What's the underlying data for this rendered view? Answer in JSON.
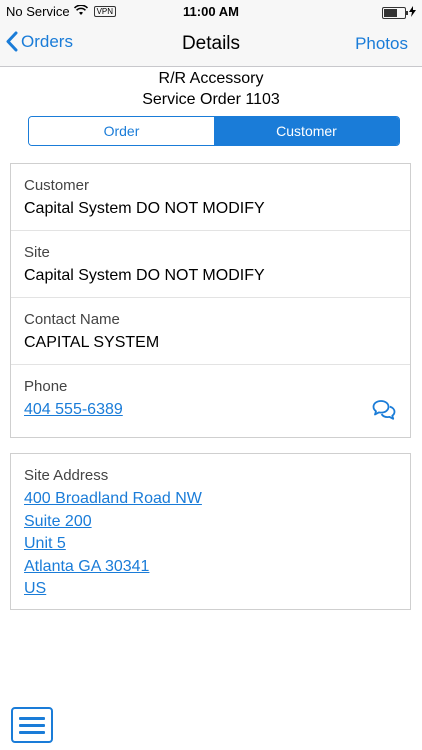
{
  "status_bar": {
    "carrier": "No Service",
    "vpn": "VPN",
    "time": "11:00 AM"
  },
  "nav": {
    "back_label": "Orders",
    "title": "Details",
    "right_label": "Photos"
  },
  "header": {
    "line1": "R/R Accessory",
    "line2": "Service Order 1103"
  },
  "tabs": [
    {
      "label": "Order",
      "selected": false
    },
    {
      "label": "Customer",
      "selected": true
    }
  ],
  "customer_card": {
    "customer_label": "Customer",
    "customer_value": "Capital System DO NOT MODIFY",
    "site_label": "Site",
    "site_value": "Capital System DO NOT MODIFY",
    "contact_label": "Contact Name",
    "contact_value": "CAPITAL SYSTEM",
    "phone_label": "Phone",
    "phone_value": "404 555-6389"
  },
  "address_card": {
    "label": "Site Address",
    "lines": [
      "400 Broadland Road NW",
      "Suite 200",
      "Unit 5",
      "Atlanta GA 30341",
      "US"
    ]
  },
  "colors": {
    "accent": "#1a7cd8",
    "nav_background": "#f7f7f7",
    "border": "#cfcfcf"
  },
  "icons": {
    "back": "chevron-left-icon",
    "phone_action": "chat-bubbles-icon",
    "menu": "hamburger-menu-icon"
  }
}
